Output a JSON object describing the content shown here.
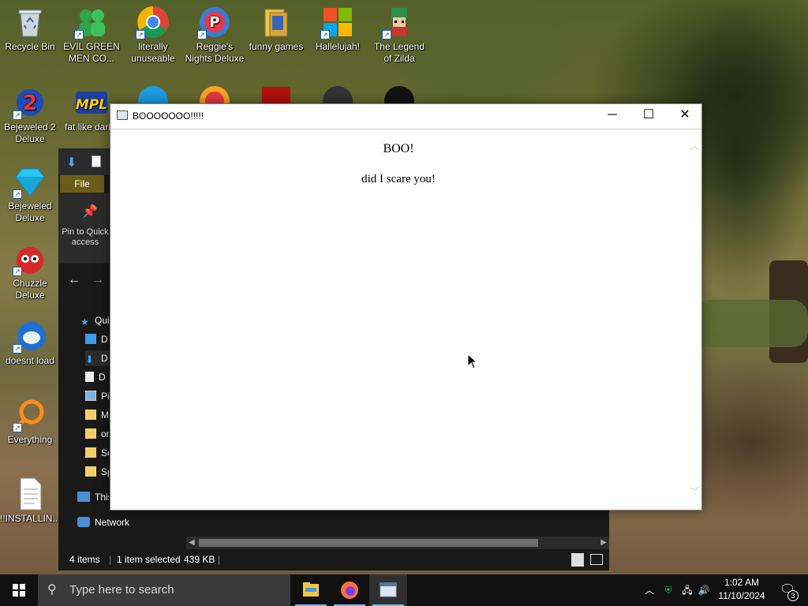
{
  "desktop": {
    "icons": [
      {
        "label": "Recycle Bin",
        "icon": "recycle-bin-icon"
      },
      {
        "label": "EVIL GREEN MEN CO...",
        "icon": "green-men-icon"
      },
      {
        "label": "literally unuseable",
        "icon": "chrome-icon"
      },
      {
        "label": "Reggie's Nights Deluxe",
        "icon": "reggie-icon"
      },
      {
        "label": "funny games",
        "icon": "folder-games-icon"
      },
      {
        "label": "Hallelujah!",
        "icon": "windows-logo-icon"
      },
      {
        "label": "The Legend of Zilda",
        "icon": "zilda-icon"
      },
      {
        "label": "Bejeweled 2 Deluxe",
        "icon": "bejeweled2-icon"
      },
      {
        "label": "fat like darl...",
        "icon": "mpl-icon"
      },
      {
        "label": "Bejeweled Deluxe",
        "icon": "diamond-icon"
      },
      {
        "label": "Chuzzle Deluxe",
        "icon": "chuzzle-icon"
      },
      {
        "label": "doesnt load",
        "icon": "thunderbird-icon"
      },
      {
        "label": "Everything",
        "icon": "everything-icon"
      },
      {
        "label": "!!INSTALLIN...",
        "icon": "text-file-icon"
      }
    ]
  },
  "explorer": {
    "file_tab": "File",
    "pin_label": "Pin to Quick access",
    "nav": [
      {
        "label": "Qui",
        "icon": "star-icon"
      },
      {
        "label": "D",
        "icon": "desktop-folder-icon"
      },
      {
        "label": "D",
        "icon": "downloads-icon"
      },
      {
        "label": "D",
        "icon": "documents-icon"
      },
      {
        "label": "Pi",
        "icon": "pictures-icon"
      },
      {
        "label": "M",
        "icon": "folder-icon"
      },
      {
        "label": "or",
        "icon": "folder-icon"
      },
      {
        "label": "Sc",
        "icon": "folder-icon"
      },
      {
        "label": "Sp",
        "icon": "folder-icon"
      },
      {
        "label": "This",
        "icon": "this-pc-icon"
      },
      {
        "label": "Network",
        "icon": "network-icon"
      }
    ],
    "status": {
      "items": "4 items",
      "selected": "1 item selected",
      "size": "439 KB"
    }
  },
  "dialog": {
    "title": "BOOOOOOO!!!!!",
    "heading": "BOO!",
    "message": "did I scare you!",
    "controls": {
      "minimize": "─",
      "maximize": "☐",
      "close": "✕"
    }
  },
  "taskbar": {
    "search_placeholder": "Type here to search",
    "apps": [
      "file-explorer-icon",
      "firefox-icon",
      "hta-app-icon"
    ],
    "clock_time": "1:02 AM",
    "clock_date": "11/10/2024",
    "notification_count": "3",
    "colors": {
      "accent": "#76b9ed",
      "bar": "#101010"
    }
  }
}
